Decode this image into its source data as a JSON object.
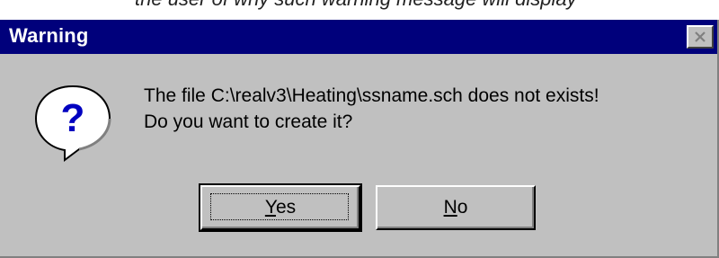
{
  "caption": "the user of why such warning message will display",
  "window": {
    "title": "Warning",
    "close_icon": "close-icon"
  },
  "message": {
    "icon": "question-icon",
    "line1": "The file C:\\realv3\\Heating\\ssname.sch does not exists!",
    "line2": "Do you want to create it?"
  },
  "buttons": {
    "yes": {
      "mnemonic": "Y",
      "rest": "es",
      "is_default": true
    },
    "no": {
      "mnemonic": "N",
      "rest": "o",
      "is_default": false
    }
  },
  "colors": {
    "titlebar": "#00007b",
    "face": "#c0c0c0",
    "title_text": "#ffffff"
  }
}
